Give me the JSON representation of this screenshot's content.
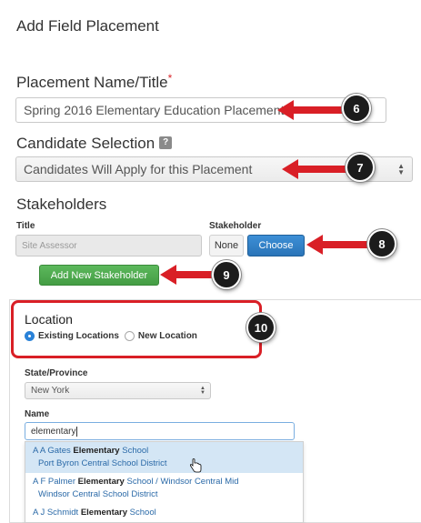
{
  "page": {
    "title": "Add Field Placement"
  },
  "placement": {
    "label": "Placement Name/Title",
    "required_mark": "*",
    "value": "Spring 2016 Elementary Education Placement"
  },
  "candidate": {
    "label": "Candidate Selection",
    "help": "?",
    "selected": "Candidates Will Apply for this Placement"
  },
  "stakeholders": {
    "label": "Stakeholders",
    "title_col": "Title",
    "stakeholder_col": "Stakeholder",
    "title_placeholder": "Site Assessor",
    "none_label": "None",
    "choose_label": "Choose",
    "add_label": "Add New Stakeholder"
  },
  "location": {
    "label": "Location",
    "option_existing": "Existing Locations",
    "option_new": "New Location",
    "selected_option": "Existing Locations",
    "state_label": "State/Province",
    "state_value": "New York",
    "name_label": "Name",
    "name_value": "elementary",
    "results": [
      {
        "prefix": "A A Gates ",
        "match": "Elementary",
        "suffix": " School",
        "district": "Port Byron Central School District"
      },
      {
        "prefix": "A F Palmer ",
        "match": "Elementary",
        "suffix": " School / Windsor Central Mid",
        "district": "Windsor Central School District"
      },
      {
        "prefix": "A J Schmidt ",
        "match": "Elementary",
        "suffix": " School",
        "district": ""
      }
    ]
  },
  "callouts": [
    "6",
    "7",
    "8",
    "9",
    "10"
  ],
  "colors": {
    "accent_red": "#d91f26",
    "choose_blue": "#2a74b8",
    "add_green": "#5cb85c",
    "selected_radio": "#2a82d8"
  }
}
